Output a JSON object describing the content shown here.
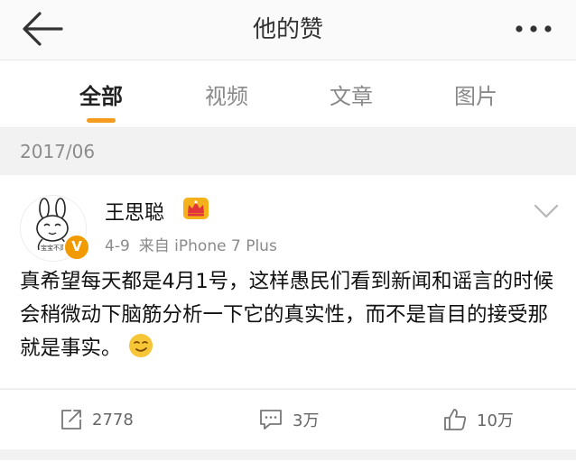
{
  "header": {
    "title": "他的赞",
    "back_icon": "back-arrow-icon",
    "more_icon": "more-dots-icon"
  },
  "tabs": [
    {
      "label": "全部",
      "active": true
    },
    {
      "label": "视频",
      "active": false
    },
    {
      "label": "文章",
      "active": false
    },
    {
      "label": "图片",
      "active": false
    }
  ],
  "accent_color": "#f59b1d",
  "date_section": "2017/06",
  "post": {
    "author": "王思聪",
    "avatar_caption": "宝宝不高",
    "verified_badge": "V",
    "date": "4-9",
    "source": "来自 iPhone 7 Plus",
    "text": "真希望每天都是4月1号，这样愚民们看到新闻和谣言的时候会稍微动下脑筋分析一下它的真实性，而不是盲目的接受那就是事实。",
    "emoji": "smirk-emoji"
  },
  "actions": {
    "repost_count": "2778",
    "comment_count": "3万",
    "like_count": "10万"
  }
}
